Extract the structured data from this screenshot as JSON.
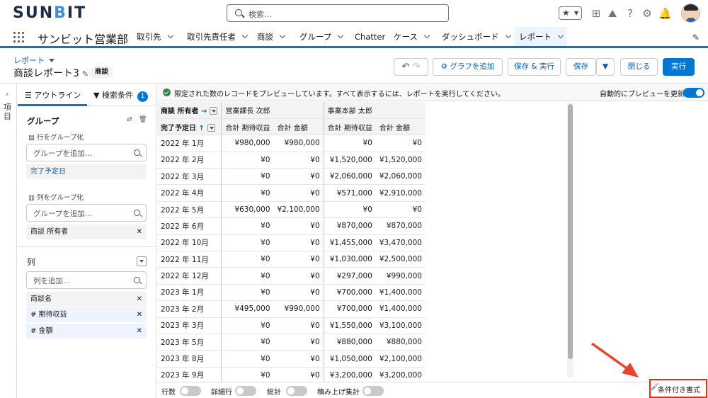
{
  "brand": {
    "logo": "SUNBIT",
    "logo_accent": "#3e8fd0"
  },
  "search": {
    "placeholder": "検索..."
  },
  "app": {
    "name": "サンビット営業部"
  },
  "nav": {
    "items": [
      "取引先",
      "取引先責任者",
      "商談",
      "グループ",
      "Chatter",
      "ケース",
      "ダッシュボード",
      "レポート"
    ],
    "active": "レポート"
  },
  "header": {
    "breadcrumb": "レポート",
    "title": "商談レポート3",
    "badge": "商談"
  },
  "buttons": {
    "add_chart": "グラフを追加",
    "save_run": "保存 & 実行",
    "save": "保存",
    "close": "閉じる",
    "run": "実行"
  },
  "panel": {
    "tab_outline": "アウトライン",
    "tab_filter": "検索条件",
    "filter_count": "1",
    "group_title": "グループ",
    "row_group_label": "行をグループ化",
    "add_group_placeholder": "グループを追加...",
    "row_group_value": "完了予定日",
    "col_group_label": "列をグループ化",
    "col_group_value": "商談 所有者",
    "columns_title": "列",
    "add_column_placeholder": "列を追加...",
    "columns": [
      "商談名",
      "# 期待収益",
      "# 金額"
    ]
  },
  "rail": {
    "label": "項目"
  },
  "notice": {
    "text": "限定された数のレコードをプレビューしています。すべて表示するには、レポートを実行してください。",
    "auto_preview": "自動的にプレビューを更新"
  },
  "table": {
    "owner_header": "商談 所有者",
    "date_header": "完了予定日",
    "groups": [
      "営業課長 次郎",
      "事業本部 太郎"
    ],
    "subheaders": [
      "合計 期待収益",
      "合計 金額",
      "合計 期待収益",
      "合計 金額"
    ],
    "rows": [
      {
        "date": "2022 年 1月",
        "v": [
          "¥980,000",
          "¥980,000",
          "¥0",
          "¥0"
        ]
      },
      {
        "date": "2022 年 2月",
        "v": [
          "¥0",
          "¥0",
          "¥1,520,000",
          "¥1,520,000"
        ]
      },
      {
        "date": "2022 年 3月",
        "v": [
          "¥0",
          "¥0",
          "¥2,060,000",
          "¥2,060,000"
        ]
      },
      {
        "date": "2022 年 4月",
        "v": [
          "¥0",
          "¥0",
          "¥571,000",
          "¥2,910,000"
        ]
      },
      {
        "date": "2022 年 5月",
        "v": [
          "¥630,000",
          "¥2,100,000",
          "¥0",
          "¥0"
        ]
      },
      {
        "date": "2022 年 6月",
        "v": [
          "¥0",
          "¥0",
          "¥870,000",
          "¥870,000"
        ]
      },
      {
        "date": "2022 年 10月",
        "v": [
          "¥0",
          "¥0",
          "¥1,455,000",
          "¥3,470,000"
        ]
      },
      {
        "date": "2022 年 11月",
        "v": [
          "¥0",
          "¥0",
          "¥1,030,000",
          "¥2,500,000"
        ]
      },
      {
        "date": "2022 年 12月",
        "v": [
          "¥0",
          "¥0",
          "¥297,000",
          "¥990,000"
        ]
      },
      {
        "date": "2023 年 1月",
        "v": [
          "¥0",
          "¥0",
          "¥700,000",
          "¥1,400,000"
        ]
      },
      {
        "date": "2023 年 2月",
        "v": [
          "¥495,000",
          "¥990,000",
          "¥700,000",
          "¥1,400,000"
        ]
      },
      {
        "date": "2023 年 3月",
        "v": [
          "¥0",
          "¥0",
          "¥1,550,000",
          "¥3,100,000"
        ]
      },
      {
        "date": "2023 年 5月",
        "v": [
          "¥0",
          "¥0",
          "¥880,000",
          "¥880,000"
        ]
      },
      {
        "date": "2023 年 8月",
        "v": [
          "¥0",
          "¥0",
          "¥1,050,000",
          "¥2,100,000"
        ]
      },
      {
        "date": "2023 年 9月",
        "v": [
          "¥0",
          "¥0",
          "¥3,200,000",
          "¥3,200,000"
        ]
      }
    ]
  },
  "footer": {
    "row_count": "行数",
    "detail_rows": "詳細行",
    "grand_total": "総計",
    "stacked_summary": "積み上げ集計",
    "conditional_format": "条件付き書式"
  },
  "colors": {
    "accent": "#0176d3",
    "highlight": "#e12c1c"
  }
}
